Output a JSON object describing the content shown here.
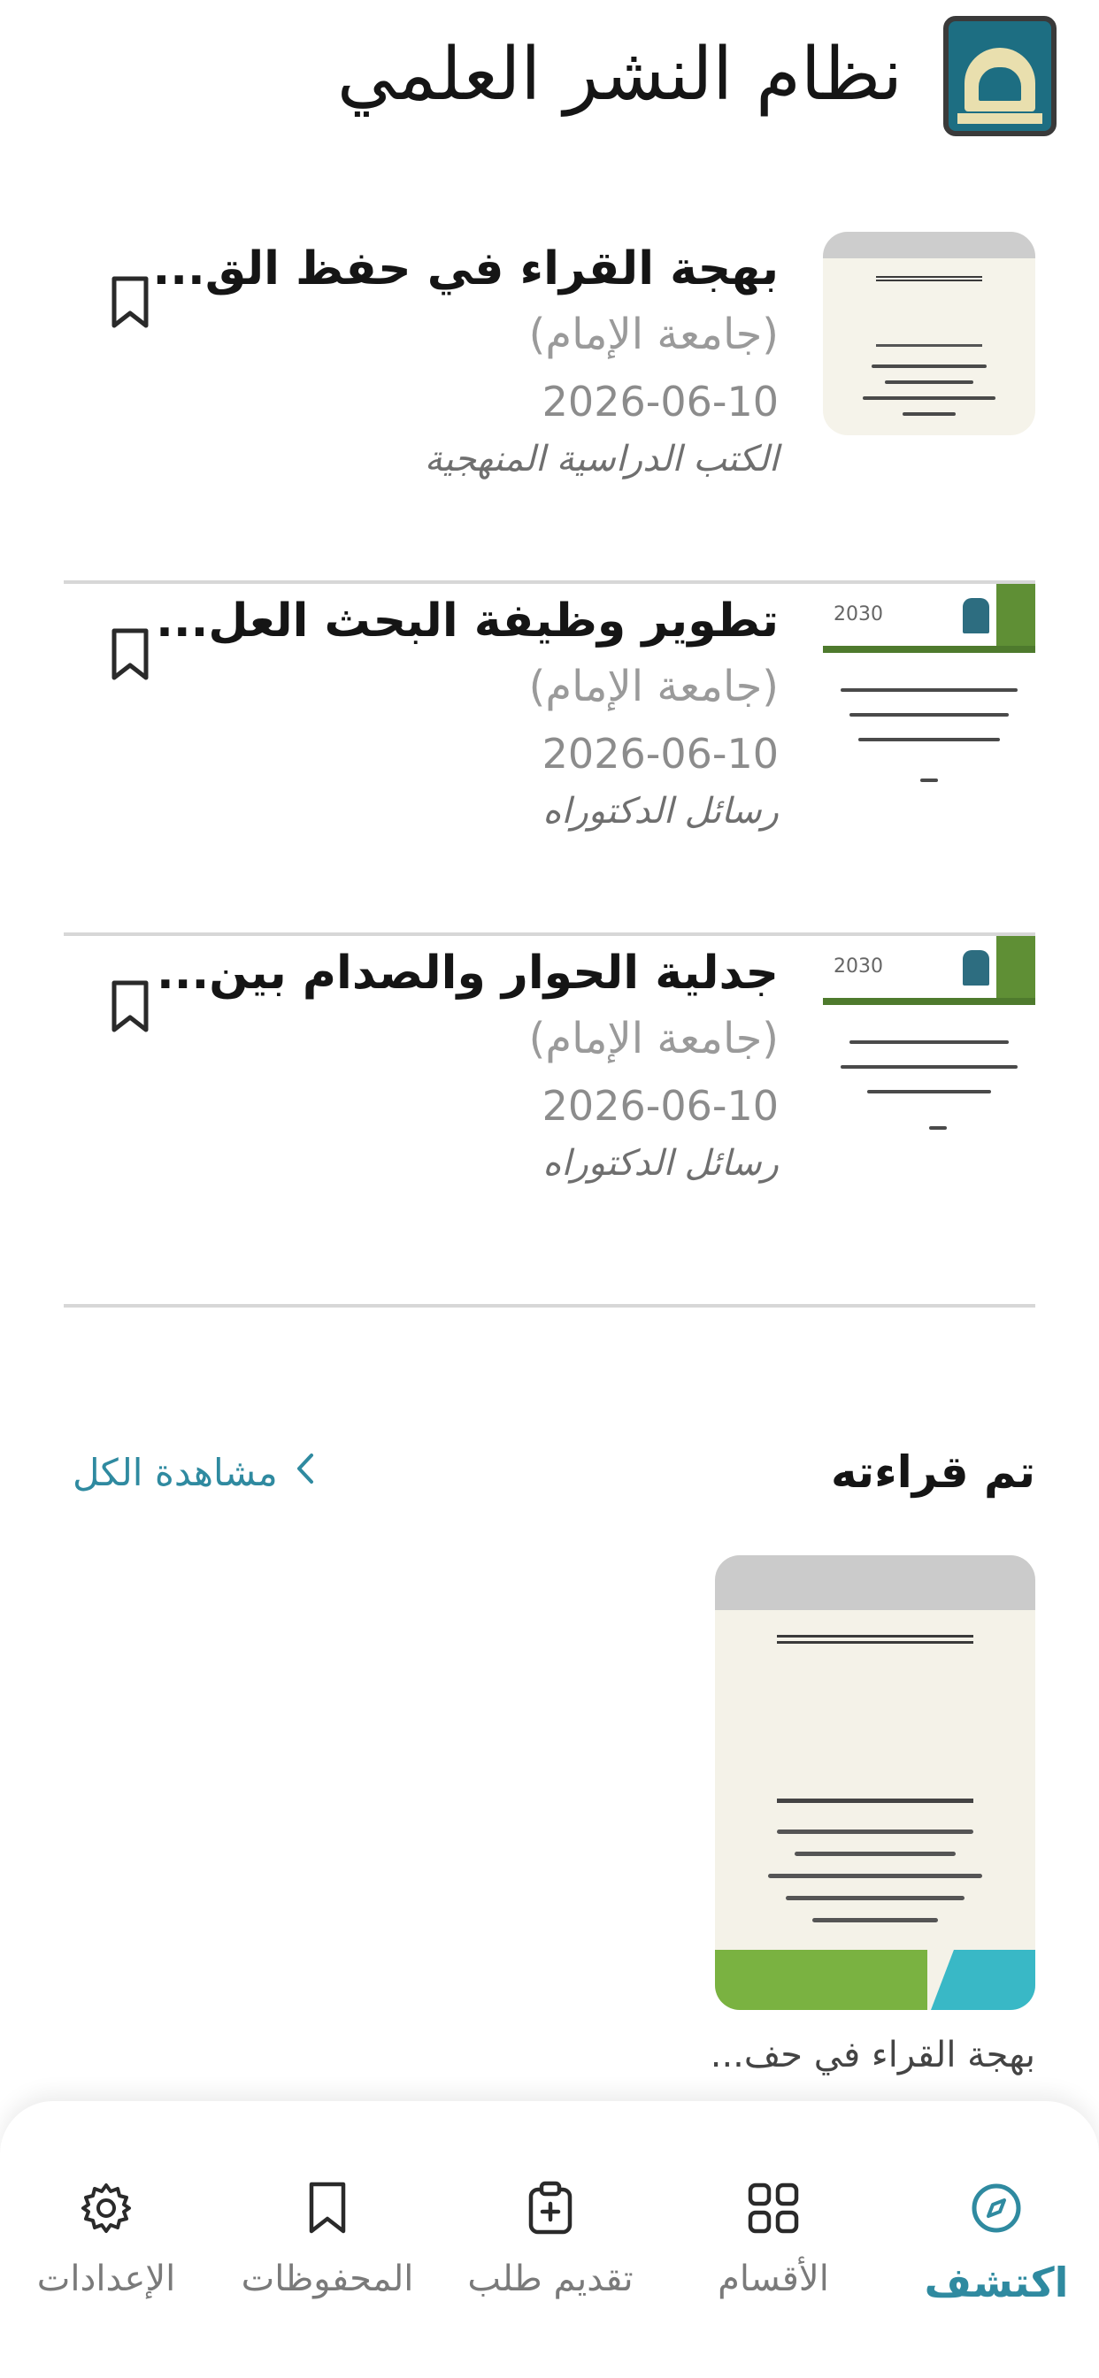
{
  "header": {
    "title": "نظام النشر العلمي",
    "logo_icon": "university-gate-logo-icon"
  },
  "results": [
    {
      "title": "بهجة القراء في حفظ الق...",
      "publisher": "(جامعة الإمام)",
      "date": "2026-06-10",
      "category": "الكتب الدراسية المنهجية",
      "bookmark_icon": "bookmark-icon"
    },
    {
      "title": "تطوير وظيفة البحث العل...",
      "publisher": "(جامعة الإمام)",
      "date": "2026-06-10",
      "category": "رسائل الدكتوراه",
      "bookmark_icon": "bookmark-icon"
    },
    {
      "title": "جدلية الحوار والصدام بين...",
      "publisher": "(جامعة الإمام)",
      "date": "2026-06-10",
      "category": "رسائل الدكتوراه",
      "bookmark_icon": "bookmark-icon"
    }
  ],
  "read_section": {
    "title": "تم قراءته",
    "view_all": "مشاهدة الكل",
    "view_all_icon": "chevron-left-icon",
    "items": [
      {
        "title": "بهجة القراء في حف..."
      }
    ]
  },
  "bottom_nav": {
    "active_color": "#2f8aa0",
    "items": [
      {
        "label": "اكتشف",
        "icon": "compass-icon",
        "active": true
      },
      {
        "label": "الأقسام",
        "icon": "grid-icon",
        "active": false
      },
      {
        "label": "تقديم طلب",
        "icon": "clipboard-plus-icon",
        "active": false
      },
      {
        "label": "المحفوظات",
        "icon": "bookmark-icon",
        "active": false
      },
      {
        "label": "الإعدادات",
        "icon": "gear-icon",
        "active": false
      }
    ]
  }
}
